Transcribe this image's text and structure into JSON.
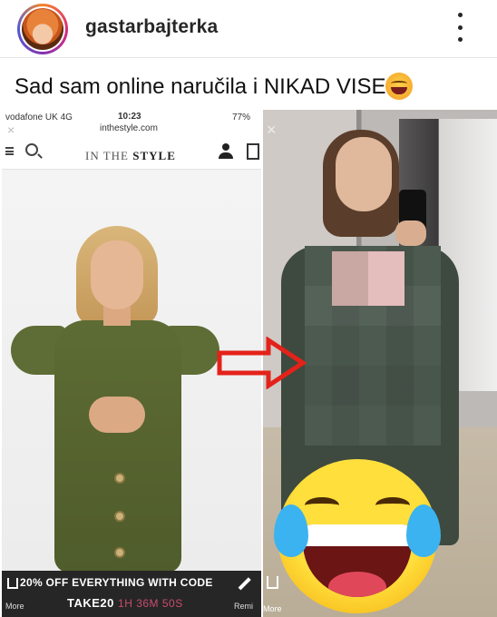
{
  "header": {
    "username": "gastarbajterka"
  },
  "post": {
    "caption": "Sad sam online naručila i NIKAD VISE",
    "emoji": "fearful-face-emoji"
  },
  "left_screenshot": {
    "status_bar": {
      "carrier": "vodafone UK  4G",
      "time": "10:23",
      "battery": "77%",
      "url": "inthestyle.com"
    },
    "brand_prefix": "IN THE",
    "brand_name": "STYLE",
    "promo": {
      "line1": "20% OFF EVERYTHING WITH CODE",
      "code": "TAKE20",
      "timer": "1H 36M 50S",
      "left_label": "More",
      "right_label": "Remi"
    }
  },
  "right_screenshot": {
    "more_label": "More"
  },
  "colors": {
    "arrow": "#e32219",
    "dress": "#56632f",
    "emoji": "#ffd93b"
  }
}
